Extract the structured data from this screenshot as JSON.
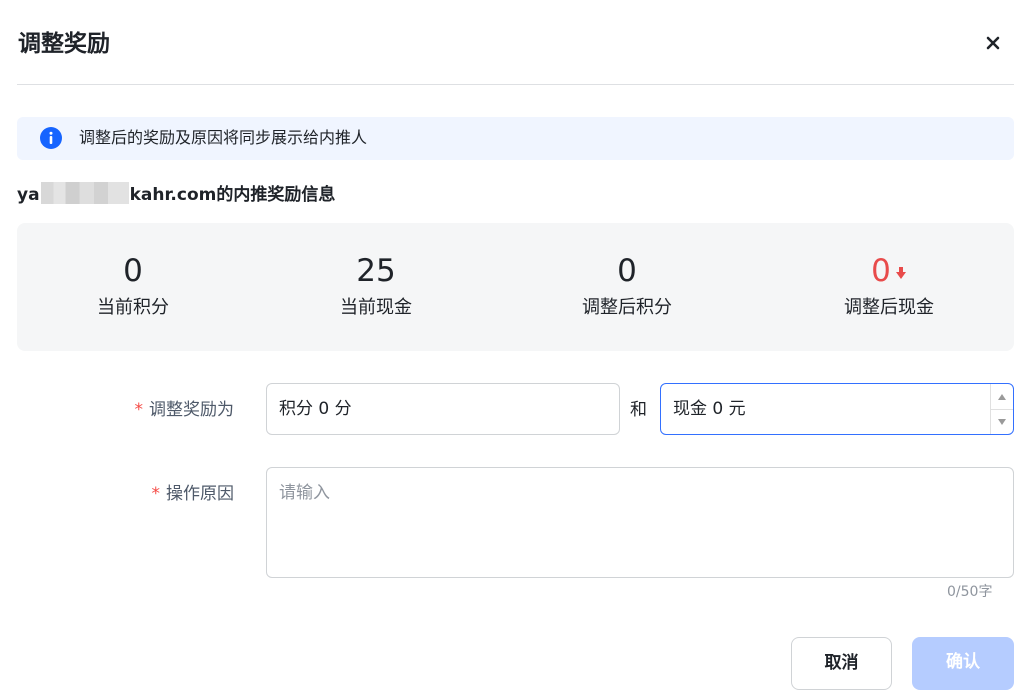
{
  "dialog": {
    "title": "调整奖励",
    "close_icon": "close-icon"
  },
  "notice": {
    "icon": "info-icon",
    "text": "调整后的奖励及原因将同步展示给内推人",
    "colors": {
      "background": "#f0f5ff",
      "icon": "#1664ff"
    }
  },
  "user": {
    "email_prefix": "ya",
    "email_suffix": "kahr.com的内推奖励信息"
  },
  "stats": [
    {
      "value": "0",
      "label": "当前积分"
    },
    {
      "value": "25",
      "label": "当前现金"
    },
    {
      "value": "0",
      "label": "调整后积分"
    },
    {
      "value": "0",
      "label": "调整后现金",
      "trend_icon": "arrow-down-icon",
      "color": "#e84b4b"
    }
  ],
  "form": {
    "required_mark": "*",
    "adjust_label": "调整奖励为",
    "points_value": "积分 0 分",
    "and_text": "和",
    "cash_value": "现金 0 元",
    "reason_label": "操作原因",
    "reason_placeholder": "请输入",
    "counter": "0/50字"
  },
  "buttons": {
    "cancel": "取消",
    "confirm": "确认",
    "confirm_color": "#b5ccff"
  }
}
